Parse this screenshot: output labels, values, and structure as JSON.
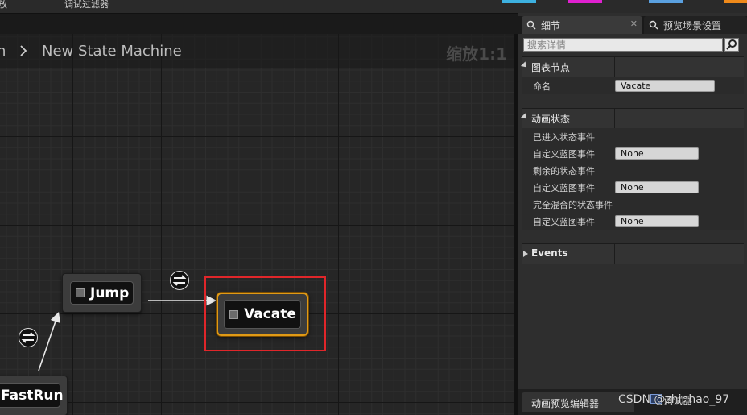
{
  "toolbar": {
    "left_label": "放",
    "filter_label": "调试过滤器",
    "swatch_colors": [
      "#3db1e0",
      "#e020d0",
      "#5aa0e0",
      "#f08a1a"
    ]
  },
  "graph": {
    "breadcrumb": {
      "parent": "n",
      "separator_icon": "chevron-right-icon",
      "current": "New State Machine"
    },
    "zoom": "缩放1:1",
    "nodes": {
      "jump": "Jump",
      "vacate": "Vacate",
      "fastrun": "FastRun"
    },
    "accent_color": "#e09a16",
    "highlight_color": "#e0262a"
  },
  "details": {
    "tabs": {
      "details": "细节",
      "preview": "预览场景设置",
      "close": "✕"
    },
    "search": {
      "placeholder": "搜索详情"
    },
    "sections": {
      "graph_node": {
        "title": "图表节点",
        "name_label": "命名",
        "name_value": "Vacate"
      },
      "anim_state": {
        "title": "动画状态",
        "entered": "已进入状态事件",
        "custom1": "自定义蓝图事件",
        "custom1_value": "None",
        "left": "剩余的状态事件",
        "custom2": "自定义蓝图事件",
        "custom2_value": "None",
        "fully": "完全混合的状态事件",
        "custom3": "自定义蓝图事件",
        "custom3_value": "None"
      },
      "events": {
        "title": "Events"
      }
    }
  },
  "bottom_tabs": {
    "anim_preview": "动画预览编辑器",
    "debug": "调试器"
  },
  "watermark": "CSDN @zhinhao_97"
}
